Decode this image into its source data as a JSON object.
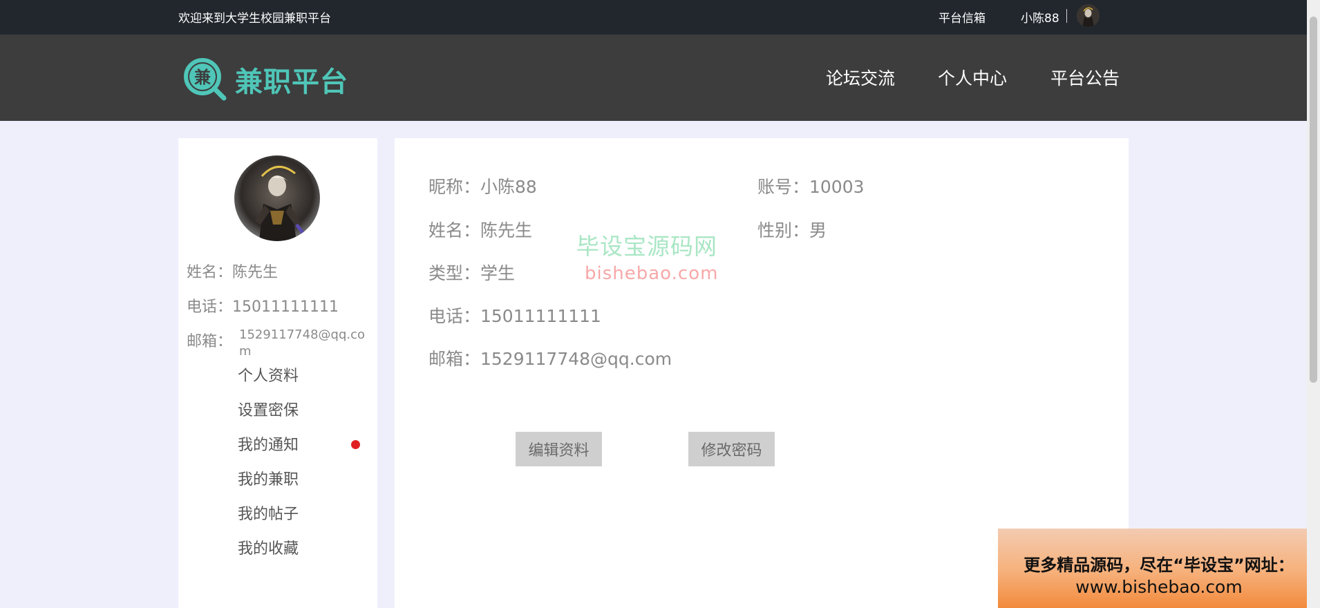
{
  "topbar": {
    "welcome": "欢迎来到大学生校园兼职平台",
    "mailbox": "平台信箱",
    "username": "小陈88"
  },
  "header": {
    "logo_char": "兼",
    "brand": "兼职平台",
    "nav": [
      "论坛交流",
      "个人中心",
      "平台公告"
    ]
  },
  "sidebar": {
    "name_label": "姓名：",
    "name": "陈先生",
    "phone_label": "电话：",
    "phone": "15011111111",
    "email_label": "邮箱：",
    "email": "1529117748@qq.com",
    "menu": [
      "个人资料",
      "设置密保",
      "我的通知",
      "我的兼职",
      "我的帖子",
      "我的收藏"
    ]
  },
  "profile": {
    "nickname": "昵称：小陈88",
    "account": "账号：10003",
    "name": "姓名：陈先生",
    "gender": "性别：男",
    "type": "类型：学生",
    "phone": "电话：15011111111",
    "email": "邮箱：1529117748@qq.com",
    "edit_button": "编辑资料",
    "password_button": "修改密码"
  },
  "watermark": {
    "cn": "毕设宝源码网",
    "en": "bishebao.com"
  },
  "promo": {
    "line1": "更多精品源码，尽在“毕设宝”网址：",
    "line2": "www.bishebao.com"
  },
  "icons": {
    "logo": "magnifier-logo-icon",
    "avatar": "avatar-image",
    "notify": "red-dot-icon"
  },
  "colors": {
    "brand": "#4fc6b8",
    "topbar": "#22272e",
    "header": "#3d3d3d",
    "page_bg": "#efeffc",
    "notify_dot": "#e02020"
  }
}
